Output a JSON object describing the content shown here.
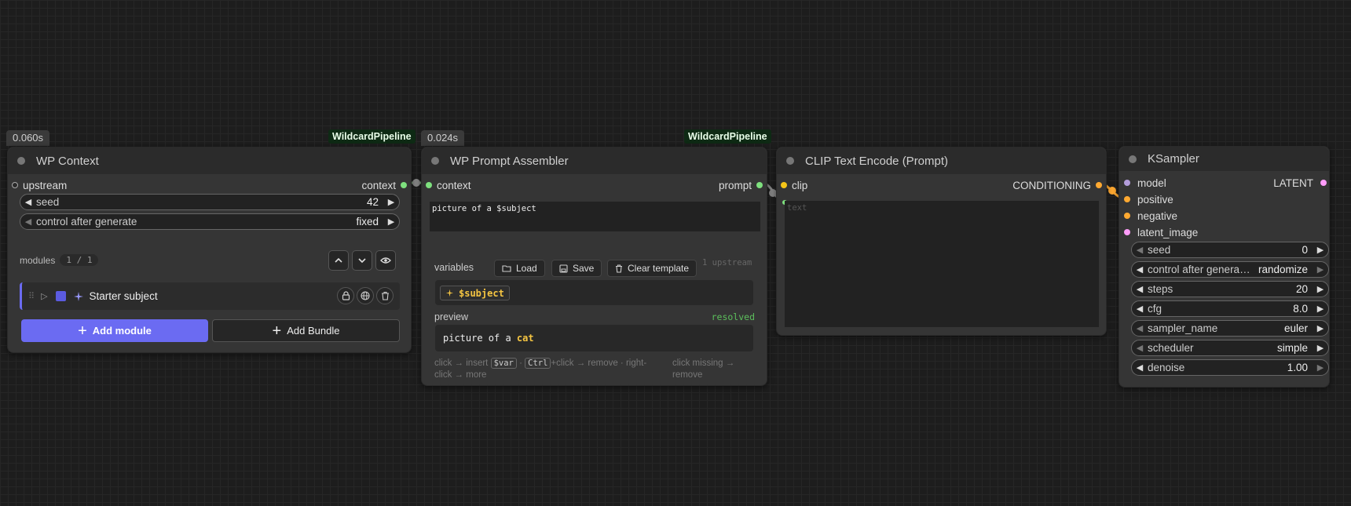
{
  "wp_context": {
    "time": "0.060s",
    "badge": "WildcardPipeline",
    "title": "WP Context",
    "inputs": {
      "upstream": "upstream"
    },
    "outputs": {
      "context": "context"
    },
    "seed": {
      "label": "seed",
      "value": "42"
    },
    "control": {
      "label": "control after generate",
      "value": "fixed"
    },
    "modules_label": "modules",
    "modules_count": "1 / 1",
    "module": {
      "name": "Starter subject",
      "color": "#5b5be0"
    },
    "add_module": "Add module",
    "add_bundle": "Add Bundle"
  },
  "wp_assembler": {
    "time": "0.024s",
    "badge": "WildcardPipeline",
    "title": "WP Prompt Assembler",
    "inputs": {
      "context": "context"
    },
    "outputs": {
      "prompt": "prompt"
    },
    "template_text": "picture of a $subject",
    "variables_label": "variables",
    "load": "Load",
    "save": "Save",
    "clear": "Clear template",
    "upstream_note": "1 upstream",
    "chip": "$subject",
    "preview_label": "preview",
    "status": "resolved",
    "preview_prefix": "picture of a ",
    "preview_value": "cat",
    "hint": {
      "a": "click → insert",
      "var": "$var",
      "b": "·",
      "ctrl": "Ctrl",
      "c": "+click → remove · right-click → more",
      "d": "click missing → remove"
    }
  },
  "clip": {
    "title": "CLIP Text Encode (Prompt)",
    "inputs": {
      "clip": "clip"
    },
    "outputs": {
      "conditioning": "CONDITIONING"
    },
    "text_placeholder": "text"
  },
  "ksampler": {
    "title": "KSampler",
    "inputs": [
      "model",
      "positive",
      "negative",
      "latent_image"
    ],
    "outputs": {
      "latent": "LATENT"
    },
    "widgets": [
      {
        "label": "seed",
        "value": "0"
      },
      {
        "label": "control after genera…",
        "value": "randomize"
      },
      {
        "label": "steps",
        "value": "20"
      },
      {
        "label": "cfg",
        "value": "8.0"
      },
      {
        "label": "sampler_name",
        "value": "euler"
      },
      {
        "label": "scheduler",
        "value": "simple"
      },
      {
        "label": "denoise",
        "value": "1.00"
      }
    ]
  },
  "colors": {
    "context_socket": "#7ee07e",
    "clip_socket": "#f5c518",
    "conditioning_socket": "#ffa931",
    "model_socket": "#b39ddb",
    "latent_socket": "#ff9cf9",
    "add_module_bg": "#6b6bf2",
    "resolved": "#5cbf5c"
  }
}
